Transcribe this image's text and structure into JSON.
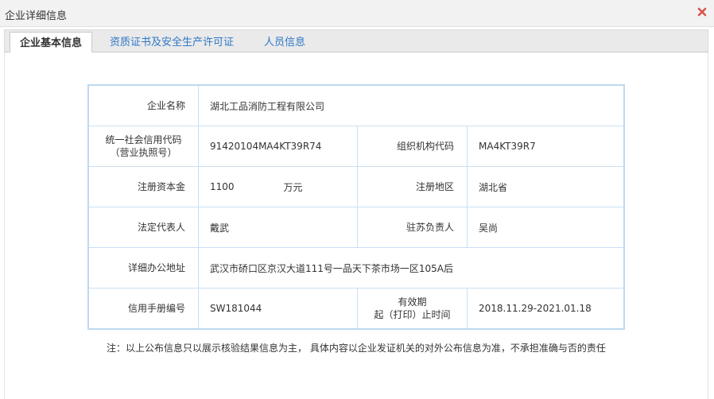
{
  "window": {
    "title": "企业详细信息",
    "close_icon": "close-icon",
    "close_color": "#d9534f"
  },
  "tabs": [
    {
      "label": "企业基本信息",
      "active": true
    },
    {
      "label": "资质证书及安全生产许可证",
      "active": false
    },
    {
      "label": "人员信息",
      "active": false
    }
  ],
  "company": {
    "name_label": "企业名称",
    "name": "湖北工品消防工程有限公司",
    "credit_code_label_line1": "统一社会信用代码",
    "credit_code_label_line2": "（营业执照号）",
    "credit_code": "91420104MA4KT39R74",
    "org_code_label": "组织机构代码",
    "org_code": "MA4KT39R7",
    "capital_label": "注册资本金",
    "capital": "1100",
    "capital_unit": "万元",
    "region_label": "注册地区",
    "region": "湖北省",
    "legal_rep_label": "法定代表人",
    "legal_rep": "戴武",
    "js_manager_label": "驻苏负责人",
    "js_manager": "吴尚",
    "address_label": "详细办公地址",
    "address": "武汉市硚口区京汉大道111号一品天下茶市场一区105A后",
    "handbook_label": "信用手册编号",
    "handbook_no": "SW181044",
    "validity_label_line1": "有效期",
    "validity_label_line2": "起（打印）止时间",
    "validity": "2018.11.29-2021.01.18"
  },
  "note": "注：以上公布信息只以展示核验结果信息为主， 具体内容以企业发证机关的对外公布信息为准，不承担准确与否的责任",
  "colors": {
    "tab_link": "#2f78c8",
    "table_border": "#bcd9f0"
  }
}
